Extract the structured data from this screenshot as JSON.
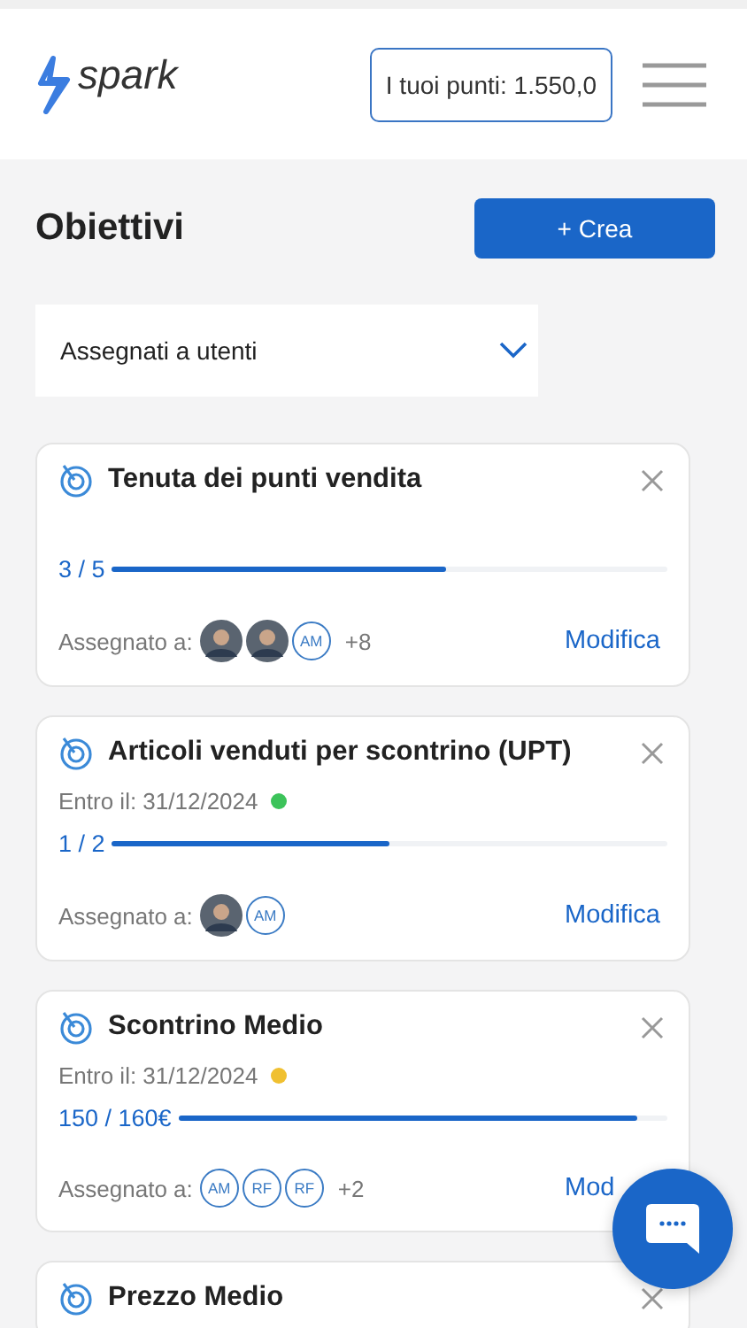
{
  "header": {
    "logo": "spark",
    "points": "I tuoi punti: 1.550,0"
  },
  "page": {
    "title": "Obiettivi",
    "create_button": "+ Crea"
  },
  "filter": {
    "value": "Assegnati a utenti"
  },
  "goals": [
    {
      "title": "Tenuta dei punti vendita",
      "progress": "3 / 5",
      "level": 0.6,
      "assigned_label": "Assegnato a:",
      "assignees": [
        {
          "kind": "photo"
        },
        {
          "kind": "photo"
        },
        {
          "kind": "initials",
          "text": "AM"
        }
      ],
      "more": "+8",
      "edit": "Modifica"
    },
    {
      "title": "Articoli venduti per scontrino (UPT)",
      "due": "Entro il: 31/12/2024",
      "color": "#3cc35a",
      "progress": "1 / 2",
      "level": 0.5,
      "assigned_label": "Assegnato a:",
      "assignees": [
        {
          "kind": "photo"
        },
        {
          "kind": "initials",
          "text": "AM"
        }
      ],
      "edit": "Modifica"
    },
    {
      "title": "Scontrino Medio",
      "due": "Entro il: 31/12/2024",
      "color": "#f0c030",
      "progress": "150 / 160€",
      "level": 0.94,
      "assigned_label": "Assegnato a:",
      "assignees": [
        {
          "kind": "initials",
          "text": "AM"
        },
        {
          "kind": "initials",
          "text": "RF"
        },
        {
          "kind": "initials",
          "text": "RF"
        }
      ],
      "more": "+2",
      "edit": "Mod"
    },
    {
      "title": "Prezzo Medio"
    }
  ]
}
